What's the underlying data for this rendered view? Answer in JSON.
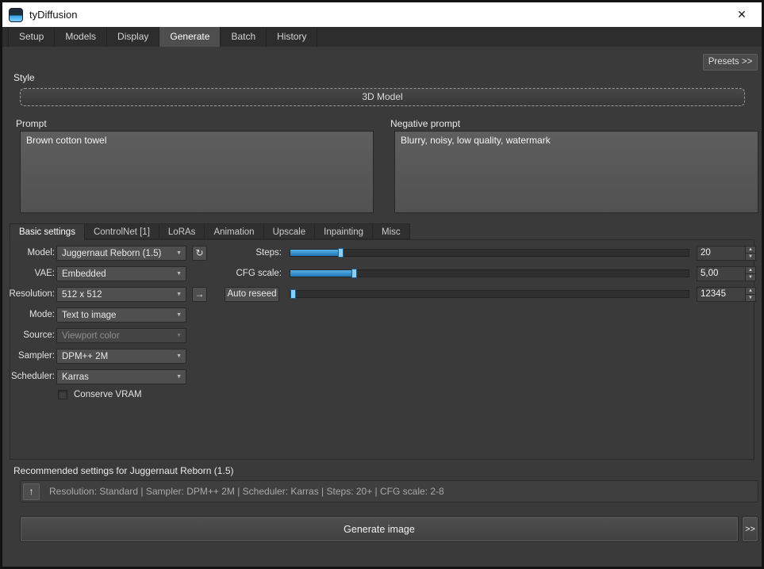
{
  "window": {
    "title": "tyDiffusion",
    "close_label": "✕"
  },
  "main_tabs": [
    "Setup",
    "Models",
    "Display",
    "Generate",
    "Batch",
    "History"
  ],
  "presets_button_label": "Presets >>",
  "style_section": {
    "label": "Style",
    "selected": "3D Model"
  },
  "prompt": {
    "label": "Prompt",
    "value": "Brown cotton towel"
  },
  "negative_prompt": {
    "label": "Negative prompt",
    "value": "Blurry, noisy, low quality, watermark"
  },
  "settings_tabs": [
    "Basic settings",
    "ControlNet [1]",
    "LoRAs",
    "Animation",
    "Upscale",
    "Inpainting",
    "Misc"
  ],
  "fields": [
    {
      "label": "Model:",
      "value": "Juggernaut Reborn (1.5)"
    },
    {
      "label": "VAE:",
      "value": "Embedded"
    },
    {
      "label": "Resolution:",
      "value": "512 x 512"
    },
    {
      "label": "Mode:",
      "value": "Text to image"
    },
    {
      "label": "Source:",
      "value": "Viewport color"
    },
    {
      "label": "Sampler:",
      "value": "DPM++ 2M"
    },
    {
      "label": "Scheduler:",
      "value": "Karras"
    }
  ],
  "conserve_vram_label": "Conserve VRAM",
  "steps": {
    "label": "Steps:",
    "value": "20",
    "fill_pct": 12.7
  },
  "cfg": {
    "label": "CFG scale:",
    "value": "5,00",
    "fill_pct": 16.2
  },
  "seed": {
    "button_label": "Auto reseed",
    "value": "12345",
    "fill_pct": 0.8
  },
  "recommended": {
    "title": "Recommended settings for Juggernaut Reborn (1.5)",
    "details": "Resolution: Standard | Sampler: DPM++ 2M | Scheduler: Karras | Steps: 20+ | CFG scale: 2-8",
    "apply_icon": "↑"
  },
  "generate": {
    "label": "Generate image",
    "more_label": ">>"
  },
  "icons": {
    "dropdown_arrow": "▼",
    "refresh": "↻",
    "apply_resolution": "→",
    "spin_up": "▲",
    "spin_down": "▼"
  },
  "colors": {
    "accent_blue": "#2e97dd",
    "titlebar_bg": "#ffffff",
    "window_bg": "#3a3a3a"
  }
}
